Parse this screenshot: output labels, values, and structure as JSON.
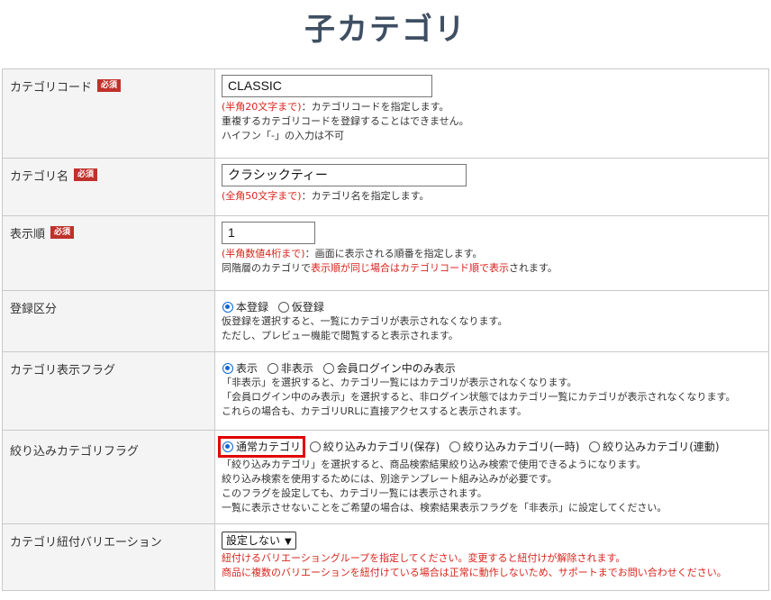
{
  "page_title": "子カテゴリ",
  "required_badge": "必須",
  "category_code": {
    "label": "カテゴリコード",
    "value": "CLASSIC",
    "limit": "(半角20文字まで)",
    "desc1": "：カテゴリコードを指定します。",
    "desc2": "重複するカテゴリコードを登録することはできません。",
    "desc3": "ハイフン「-」の入力は不可"
  },
  "category_name": {
    "label": "カテゴリ名",
    "value": "クラシックティー",
    "limit": "(全角50文字まで)",
    "desc1": "：カテゴリ名を指定します。"
  },
  "display_order": {
    "label": "表示順",
    "value": "1",
    "limit": "(半角数値4桁まで)",
    "desc1": "：画面に表示される順番を指定します。",
    "desc2a": "同階層のカテゴリで",
    "desc2b": "表示順が同じ場合はカテゴリコード順で表示",
    "desc2c": "されます。"
  },
  "registration": {
    "label": "登録区分",
    "options": [
      "本登録",
      "仮登録"
    ],
    "selected": "本登録",
    "desc1": "仮登録を選択すると、一覧にカテゴリが表示されなくなります。",
    "desc2": "ただし、プレビュー機能で閲覧すると表示されます。"
  },
  "display_flag": {
    "label": "カテゴリ表示フラグ",
    "options": [
      "表示",
      "非表示",
      "会員ログイン中のみ表示"
    ],
    "selected": "表示",
    "desc1": "「非表示」を選択すると、カテゴリ一覧にはカテゴリが表示されなくなります。",
    "desc2": "「会員ログイン中のみ表示」を選択すると、非ログイン状態ではカテゴリ一覧にカテゴリが表示されなくなります。",
    "desc3": "これらの場合も、カテゴリURLに直接アクセスすると表示されます。"
  },
  "filter_flag": {
    "label": "絞り込みカテゴリフラグ",
    "options": [
      "通常カテゴリ",
      "絞り込みカテゴリ(保存)",
      "絞り込みカテゴリ(一時)",
      "絞り込みカテゴリ(連動)"
    ],
    "selected": "通常カテゴリ",
    "desc1": "「絞り込みカテゴリ」を選択すると、商品検索結果絞り込み検索で使用できるようになります。",
    "desc2": "絞り込み検索を使用するためには、別途テンプレート組み込みが必要です。",
    "desc3": "このフラグを設定しても、カテゴリ一覧には表示されます。",
    "desc4": "一覧に表示させないことをご希望の場合は、検索結果表示フラグを「非表示」に設定してください。"
  },
  "variation": {
    "label": "カテゴリ紐付バリエーション",
    "select_value": "設定しない",
    "desc1": "紐付けるバリエーショングループを指定してください。変更すると紐付けが解除されます。",
    "desc2": "商品に複数のバリエーションを紐付けている場合は正常に動作しないため、サポートまでお問い合わせください。"
  },
  "colors": {
    "accent": "#0b66d6",
    "required": "#c0312b",
    "warning": "#d9241c",
    "highlight": "#e00000",
    "title": "#3f4f63"
  }
}
